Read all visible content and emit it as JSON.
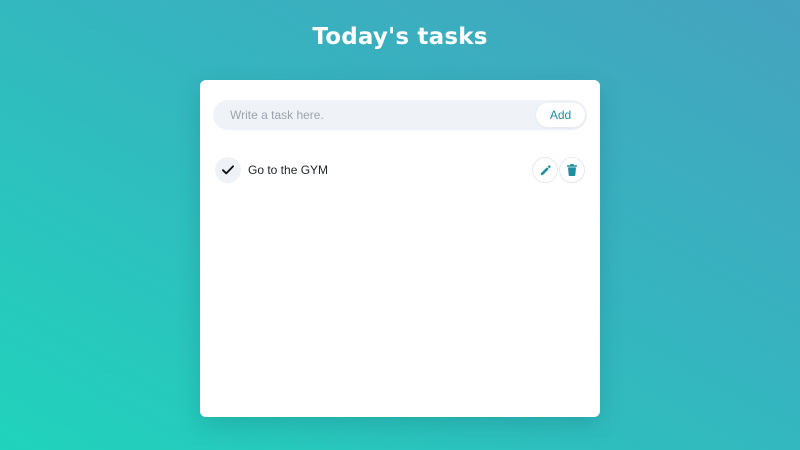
{
  "header": {
    "title": "Today's tasks"
  },
  "task_input": {
    "placeholder": "Write a task here.",
    "value": ""
  },
  "add_button": {
    "label": "Add"
  },
  "tasks": [
    {
      "text": "Go to the GYM",
      "completed": true
    }
  ],
  "colors": {
    "accent": "#1f8fa0",
    "background_start": "#20d3bc",
    "background_end": "#45a3bf"
  },
  "icons": {
    "complete": "check-icon",
    "edit": "pencil-icon",
    "delete": "trash-icon"
  }
}
